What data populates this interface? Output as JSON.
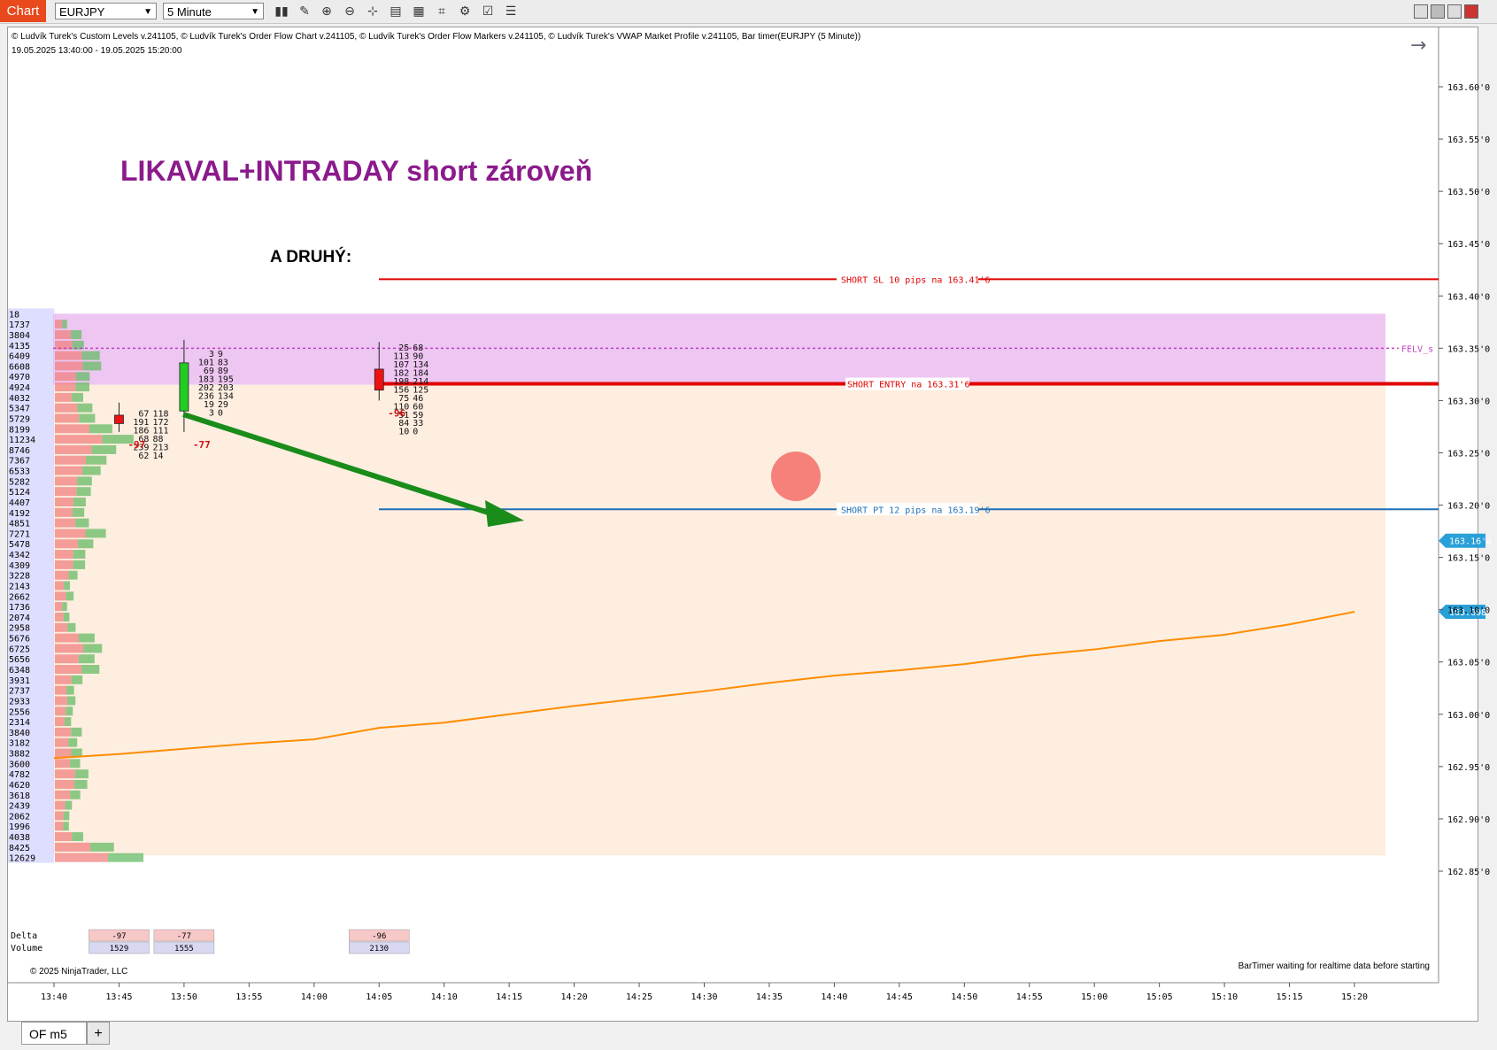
{
  "toolbar": {
    "chart_tab": "Chart",
    "instrument": "EURJPY",
    "interval": "5 Minute",
    "icons": [
      "bar-type-icon",
      "draw-tool-icon",
      "zoom-in-icon",
      "zoom-out-icon",
      "crosshair-icon",
      "data-box-icon",
      "templates-icon",
      "indicators-icon",
      "strategies-icon",
      "properties-icon"
    ]
  },
  "header": {
    "indicators": "© Ludvík Turek's Custom Levels v.241105, © Ludvík Turek's Order Flow Chart v.241105, © Ludvík Turek's Order Flow Markers v.241105, © Ludvík Turek's VWAP Market Profile v.241105, Bar timer(EURJPY (5 Minute))",
    "date_range": "19.05.2025 13:40:00 - 19.05.2025 15:20:00",
    "arrow_glyph": "→"
  },
  "annotations": {
    "headline": "LIKAVAL+INTRADAY short zároveň",
    "subhead": "A DRUHÝ:"
  },
  "levels": {
    "sl_label": "SHORT SL 10 pips na 163.41'6",
    "entry_label": "SHORT ENTRY na 163.31'6",
    "pt_label": "SHORT PT 12 pips na 163.19'6",
    "felv_label": "FELV_s"
  },
  "copyright": "© 2025 NinjaTrader, LLC",
  "bartimer": "BarTimer waiting for realtime data before starting",
  "tabs": {
    "active": "OF m5",
    "add": "+"
  },
  "colors": {
    "up": "#22cc22",
    "down": "#ee1111",
    "vwap": "#ff8c00",
    "headline": "#8b1a8b",
    "arrow": "#1a8c1a",
    "sl": "#e00000",
    "entry": "#e00000",
    "pt": "#1f6fb5"
  },
  "chart_data": {
    "type": "candlestick",
    "instrument": "EURJPY",
    "timeframe": "5 Minute",
    "y_axis": {
      "ticks": [
        "163.60'0",
        "163.55'0",
        "163.50'0",
        "163.45'0",
        "163.40'0",
        "163.35'0",
        "163.30'0",
        "163.25'0",
        "163.20'0",
        "163.15'0",
        "163.10'0",
        "163.05'0",
        "163.00'0",
        "162.95'0",
        "162.90'0",
        "162.85'0"
      ]
    },
    "x_axis": {
      "ticks": [
        "13:40",
        "13:45",
        "13:50",
        "13:55",
        "14:00",
        "14:05",
        "14:10",
        "14:15",
        "14:20",
        "14:25",
        "14:30",
        "14:35",
        "14:40",
        "14:45",
        "14:50",
        "14:55",
        "15:00",
        "15:05",
        "15:10",
        "15:15",
        "15:20"
      ]
    },
    "price_badges": [
      "163.16'6",
      "163.098"
    ],
    "rows": {
      "delta_label": "Delta",
      "volume_label": "Volume"
    },
    "bars": [
      {
        "time": "13:45",
        "open": 163.286,
        "high": 163.298,
        "low": 163.27,
        "close": 163.278,
        "delta": -97,
        "volume": 1529,
        "delta_label": "-97",
        "volume_label": "1529",
        "cluster": [
          {
            "p": 163.288,
            "b": "67",
            "a": "118"
          },
          {
            "p": 163.28,
            "b": "191",
            "a": "172"
          },
          {
            "p": 163.272,
            "b": "186",
            "a": "111"
          },
          {
            "p": 163.264,
            "b": "68",
            "a": "88"
          },
          {
            "p": 163.256,
            "b": "239",
            "a": "213"
          },
          {
            "p": 163.248,
            "b": "62",
            "a": "14"
          }
        ],
        "marker": "-97"
      },
      {
        "time": "13:50",
        "open": 163.29,
        "high": 163.358,
        "low": 163.27,
        "close": 163.336,
        "delta": -77,
        "volume": 1555,
        "delta_label": "-77",
        "volume_label": "1555",
        "cluster": [
          {
            "p": 163.345,
            "b": "3",
            "a": "9"
          },
          {
            "p": 163.337,
            "b": "101",
            "a": "83"
          },
          {
            "p": 163.329,
            "b": "69",
            "a": "89"
          },
          {
            "p": 163.321,
            "b": "183",
            "a": "195"
          },
          {
            "p": 163.313,
            "b": "202",
            "a": "203"
          },
          {
            "p": 163.305,
            "b": "236",
            "a": "134"
          },
          {
            "p": 163.297,
            "b": "19",
            "a": "29"
          },
          {
            "p": 163.289,
            "b": "3",
            "a": "0"
          }
        ],
        "marker": "-77"
      },
      {
        "time": "14:05",
        "open": 163.33,
        "high": 163.356,
        "low": 163.3,
        "close": 163.31,
        "delta": -96,
        "volume": 2130,
        "delta_label": "-96",
        "volume_label": "2130",
        "cluster": [
          {
            "p": 163.351,
            "b": "25",
            "a": "68"
          },
          {
            "p": 163.343,
            "b": "113",
            "a": "90"
          },
          {
            "p": 163.335,
            "b": "107",
            "a": "134"
          },
          {
            "p": 163.327,
            "b": "182",
            "a": "184"
          },
          {
            "p": 163.319,
            "b": "198",
            "a": "214"
          },
          {
            "p": 163.311,
            "b": "156",
            "a": "125"
          },
          {
            "p": 163.303,
            "b": "75",
            "a": "46"
          },
          {
            "p": 163.295,
            "b": "110",
            "a": "60"
          },
          {
            "p": 163.287,
            "b": "51",
            "a": "59"
          },
          {
            "p": 163.279,
            "b": "84",
            "a": "33"
          },
          {
            "p": 163.271,
            "b": "10",
            "a": "0"
          }
        ],
        "marker": "-96"
      }
    ],
    "profile": [
      {
        "p": 163.383,
        "v": 18
      },
      {
        "p": 163.373,
        "v": 1737
      },
      {
        "p": 163.363,
        "v": 3804
      },
      {
        "p": 163.353,
        "v": 4135
      },
      {
        "p": 163.343,
        "v": 6409
      },
      {
        "p": 163.333,
        "v": 6608
      },
      {
        "p": 163.323,
        "v": 4970
      },
      {
        "p": 163.313,
        "v": 4924
      },
      {
        "p": 163.303,
        "v": 4032
      },
      {
        "p": 163.293,
        "v": 5347
      },
      {
        "p": 163.283,
        "v": 5729
      },
      {
        "p": 163.273,
        "v": 8199
      },
      {
        "p": 163.263,
        "v": 11234
      },
      {
        "p": 163.253,
        "v": 8746
      },
      {
        "p": 163.243,
        "v": 7367
      },
      {
        "p": 163.233,
        "v": 6533
      },
      {
        "p": 163.223,
        "v": 5282
      },
      {
        "p": 163.213,
        "v": 5124
      },
      {
        "p": 163.203,
        "v": 4407
      },
      {
        "p": 163.193,
        "v": 4192
      },
      {
        "p": 163.183,
        "v": 4851
      },
      {
        "p": 163.173,
        "v": 7271
      },
      {
        "p": 163.163,
        "v": 5478
      },
      {
        "p": 163.153,
        "v": 4342
      },
      {
        "p": 163.143,
        "v": 4309
      },
      {
        "p": 163.133,
        "v": 3228
      },
      {
        "p": 163.123,
        "v": 2143
      },
      {
        "p": 163.113,
        "v": 2662
      },
      {
        "p": 163.103,
        "v": 1736
      },
      {
        "p": 163.093,
        "v": 2074
      },
      {
        "p": 163.083,
        "v": 2958
      },
      {
        "p": 163.073,
        "v": 5676
      },
      {
        "p": 163.063,
        "v": 6725
      },
      {
        "p": 163.053,
        "v": 5656
      },
      {
        "p": 163.043,
        "v": 6348
      },
      {
        "p": 163.033,
        "v": 3931
      },
      {
        "p": 163.023,
        "v": 2737
      },
      {
        "p": 163.013,
        "v": 2933
      },
      {
        "p": 163.003,
        "v": 2556
      },
      {
        "p": 162.993,
        "v": 2314
      },
      {
        "p": 162.983,
        "v": 3840
      },
      {
        "p": 162.973,
        "v": 3182
      },
      {
        "p": 162.963,
        "v": 3882
      },
      {
        "p": 162.953,
        "v": 3600
      },
      {
        "p": 162.943,
        "v": 4782
      },
      {
        "p": 162.933,
        "v": 4620
      },
      {
        "p": 162.923,
        "v": 3618
      },
      {
        "p": 162.913,
        "v": 2439
      },
      {
        "p": 162.903,
        "v": 2062
      },
      {
        "p": 162.893,
        "v": 1996
      },
      {
        "p": 162.883,
        "v": 4038
      },
      {
        "p": 162.873,
        "v": 8425
      },
      {
        "p": 162.863,
        "v": 12629
      }
    ],
    "vwap": [
      {
        "time": "13:40",
        "v": 162.958
      },
      {
        "time": "13:45",
        "v": 162.962
      },
      {
        "time": "13:50",
        "v": 162.967
      },
      {
        "time": "13:55",
        "v": 162.972
      },
      {
        "time": "14:00",
        "v": 162.976
      },
      {
        "time": "14:05",
        "v": 162.987
      },
      {
        "time": "14:10",
        "v": 162.992
      },
      {
        "time": "14:15",
        "v": 163.0
      },
      {
        "time": "14:20",
        "v": 163.008
      },
      {
        "time": "14:25",
        "v": 163.015
      },
      {
        "time": "14:30",
        "v": 163.022
      },
      {
        "time": "14:35",
        "v": 163.03
      },
      {
        "time": "14:40",
        "v": 163.037
      },
      {
        "time": "14:45",
        "v": 163.042
      },
      {
        "time": "14:50",
        "v": 163.048
      },
      {
        "time": "14:55",
        "v": 163.056
      },
      {
        "time": "15:00",
        "v": 163.062
      },
      {
        "time": "15:05",
        "v": 163.07
      },
      {
        "time": "15:10",
        "v": 163.076
      },
      {
        "time": "15:15",
        "v": 163.086
      },
      {
        "time": "15:20",
        "v": 163.098
      }
    ]
  }
}
